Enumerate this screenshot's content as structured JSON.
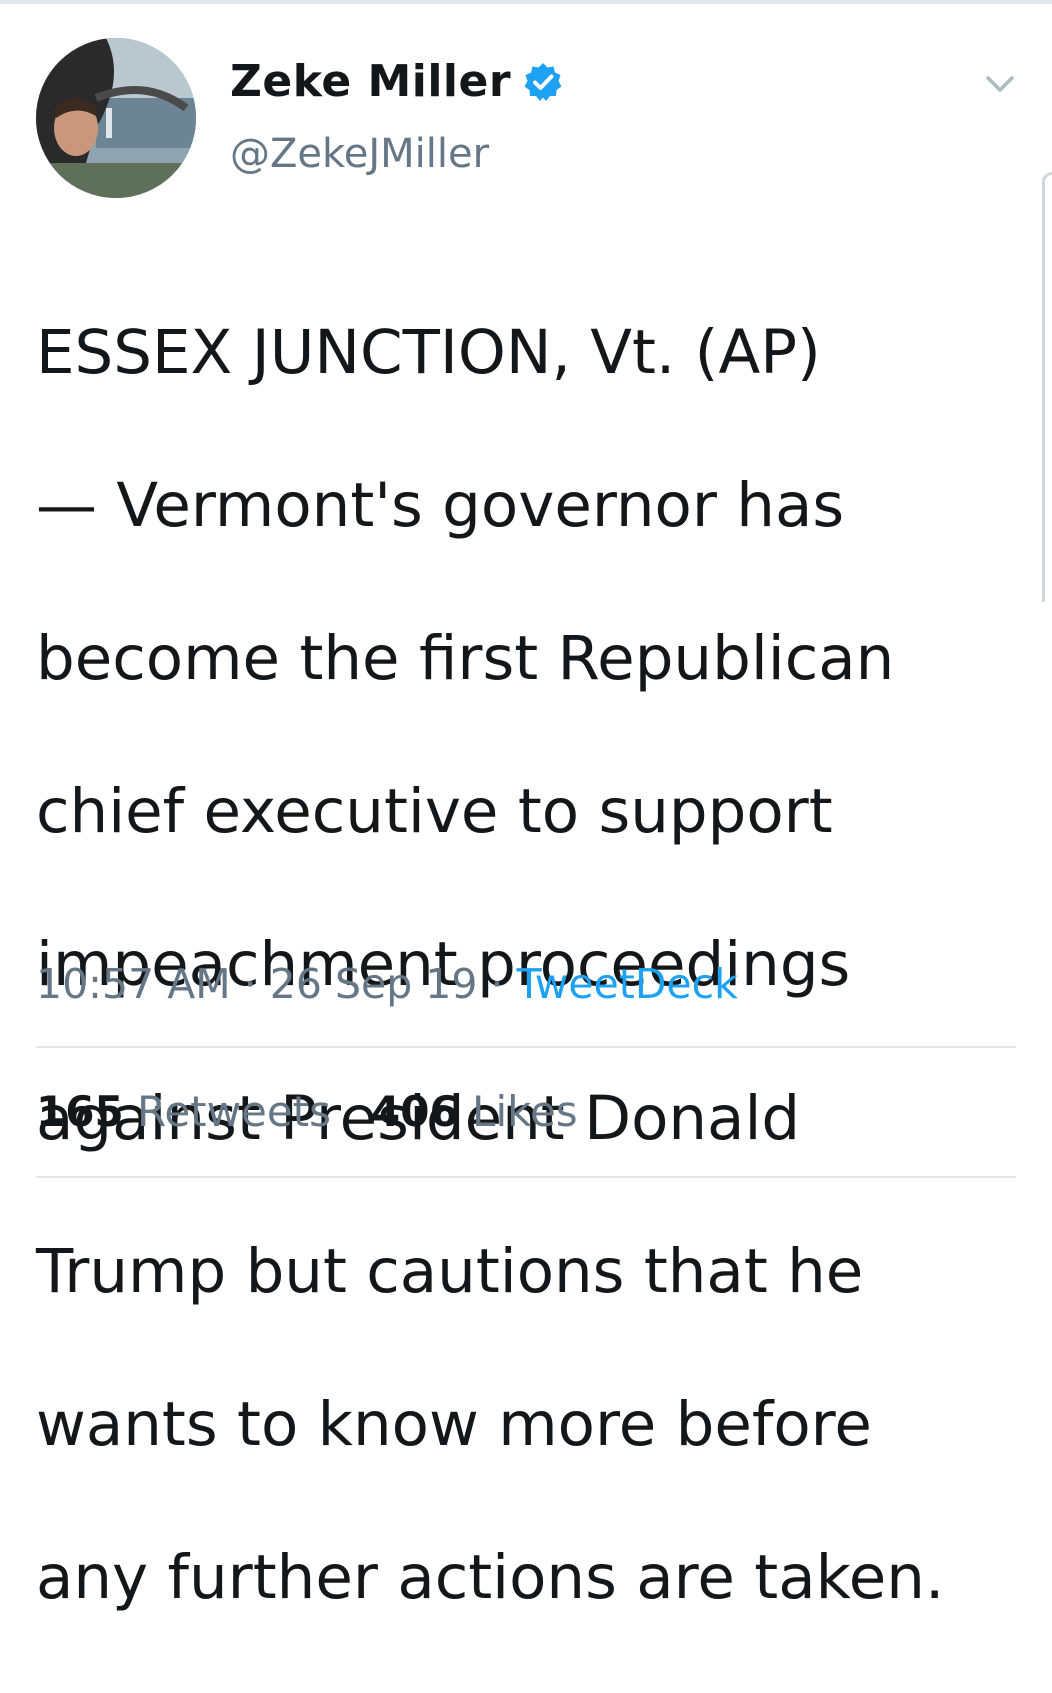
{
  "user": {
    "display_name": "Zeke Miller",
    "handle": "@ZekeJMiller"
  },
  "tweet": {
    "text_lines": [
      "ESSEX JUNCTION, Vt. (AP)",
      "— Vermont's governor has",
      "become the first Republican",
      "chief executive to support",
      "impeachment proceedings",
      "against President Donald",
      "Trump but cautions that he",
      "wants to know more before",
      "any further actions are taken."
    ],
    "time": "10:57 AM",
    "separator": " · ",
    "date": "26 Sep 19",
    "source": "TweetDeck"
  },
  "stats": {
    "retweets_count": "165",
    "retweets_label": "Retweets",
    "likes_count": "406",
    "likes_label": "Likes"
  },
  "icons": {
    "verified": "verified-badge-icon",
    "caret": "chevron-down-icon"
  },
  "colors": {
    "accent": "#1da1f2",
    "text_primary": "#14171a",
    "text_secondary": "#657786",
    "divider": "#e1e8ed"
  }
}
